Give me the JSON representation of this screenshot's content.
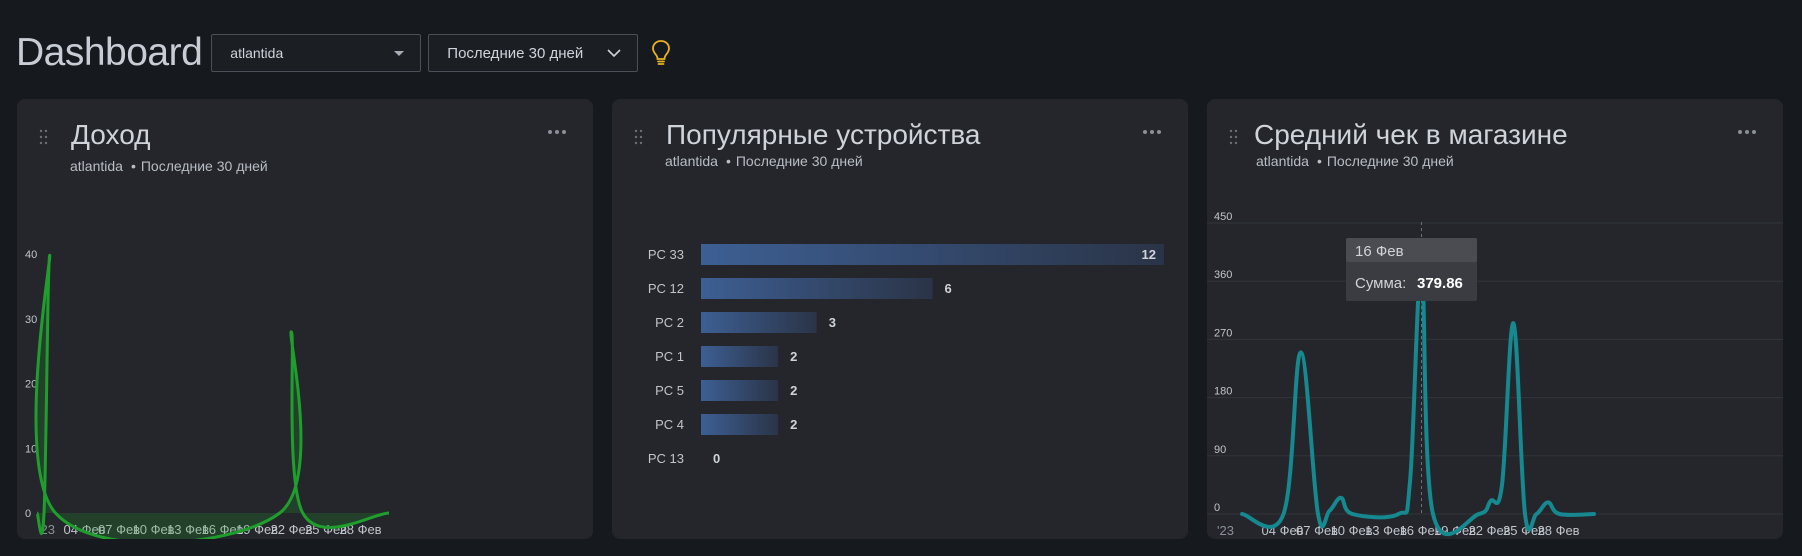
{
  "header": {
    "title": "Dashboard",
    "store_select": "atlantida",
    "period_select": "Последние 30 дней"
  },
  "cards": [
    {
      "title": "Доход",
      "store": "atlantida",
      "period": "Последние 30 дней",
      "chart_data": {
        "type": "area",
        "x": [
          "'23",
          "04 Фев",
          "07 Фев",
          "10 Фев",
          "13 Фев",
          "16 Фев",
          "19 Фев",
          "22 Фев",
          "25 Фев",
          "28 Фев"
        ],
        "y_ticks": [
          0,
          10,
          20,
          30,
          40
        ],
        "ylim": [
          0,
          40
        ],
        "series": [
          {
            "values": [
              [
                -0.6,
                0
              ],
              [
                0,
                0
              ],
              [
                0.5,
                39.8
              ],
              [
                1,
                0
              ],
              [
                20.5,
                0
              ],
              [
                21.5,
                28
              ],
              [
                22.5,
                0
              ],
              [
                30,
                0
              ]
            ]
          }
        ],
        "color": "#1f9e2e"
      }
    },
    {
      "title": "Популярные устройства",
      "store": "atlantida",
      "period": "Последние 30 дней",
      "chart_data": {
        "type": "bar",
        "categories": [
          "PC 33",
          "PC 12",
          "PC 2",
          "PC 1",
          "PC 5",
          "PC 4",
          "PC 13"
        ],
        "values": [
          12,
          6,
          3,
          2,
          2,
          2,
          0
        ],
        "color": "#3a5a8c"
      }
    },
    {
      "title": "Средний чек в магазине",
      "store": "atlantida",
      "period": "Последние 30 дней",
      "chart_data": {
        "type": "line",
        "x": [
          "'23",
          "04 Фев",
          "07 Фев",
          "10 Фев",
          "13 Фев",
          "16 Фев",
          "19 Фев",
          "22 Фев",
          "25 Фев",
          "28 Фев"
        ],
        "y_ticks": [
          0,
          90,
          180,
          270,
          360,
          450
        ],
        "ylim": [
          0,
          450
        ],
        "series": [
          {
            "values": [
              [
                -0.6,
                0
              ],
              [
                3,
                0
              ],
              [
                4.5,
                250
              ],
              [
                6,
                0
              ],
              [
                7,
                5
              ],
              [
                8,
                25
              ],
              [
                9,
                0
              ],
              [
                13,
                0
              ],
              [
                14,
                50
              ],
              [
                15,
                379.86
              ],
              [
                16,
                0
              ],
              [
                20,
                0
              ],
              [
                21,
                20
              ],
              [
                22,
                45
              ],
              [
                23,
                295
              ],
              [
                24,
                0
              ],
              [
                25,
                0
              ],
              [
                26,
                18
              ],
              [
                27,
                0
              ],
              [
                30,
                0
              ]
            ]
          }
        ],
        "color": "#16888f",
        "tooltip": {
          "date": "16 Фев",
          "label": "Сумма:",
          "value": "379.86",
          "x": 15,
          "y": 379.86
        }
      }
    }
  ]
}
